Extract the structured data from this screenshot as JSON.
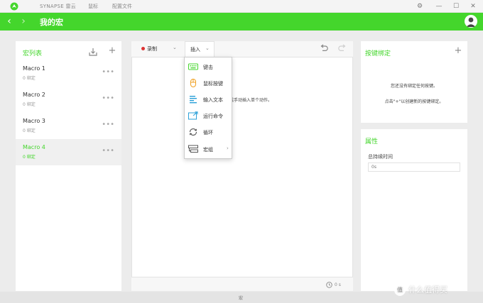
{
  "titlebar": {
    "app_name": "SYNAPSE 雷云",
    "menu_mouse": "鼠标",
    "menu_profile": "配置文件",
    "gear_glyph": "⚙",
    "minimize_glyph": "—",
    "maximize_glyph": "☐",
    "close_glyph": "✕"
  },
  "header": {
    "title": "我的宏",
    "back_glyph": "‹",
    "forward_glyph": "›",
    "accent_color": "#44d62c"
  },
  "macro_list": {
    "title": "宏列表",
    "items": [
      {
        "name": "Macro 1",
        "sub": "0 绑定",
        "active": false
      },
      {
        "name": "Macro 2",
        "sub": "0 绑定",
        "active": false
      },
      {
        "name": "Macro 3",
        "sub": "0 绑定",
        "active": false
      },
      {
        "name": "Macro 4",
        "sub": "0 绑定",
        "active": true
      }
    ],
    "more_glyph": "•••",
    "add_glyph": "+"
  },
  "editor": {
    "record_label": "录制",
    "insert_label": "插入",
    "caret_glyph": "⌄",
    "hint_text": "作或手动插入单个动作。",
    "timer_value": "0 s"
  },
  "insert_menu": {
    "items": [
      {
        "label": "键击",
        "icon": "keyboard-icon"
      },
      {
        "label": "鼠标按键",
        "icon": "mouse-icon"
      },
      {
        "label": "输入文本",
        "icon": "text-icon"
      },
      {
        "label": "运行命令",
        "icon": "run-command-icon"
      },
      {
        "label": "循环",
        "icon": "loop-icon"
      },
      {
        "label": "宏组",
        "icon": "macro-group-icon"
      }
    ],
    "submenu_glyph": "›"
  },
  "bindings": {
    "title": "按键绑定",
    "empty_line1": "您还没有绑定任何按键。",
    "empty_line2": "点击\"+\"以创建新的按键绑定。",
    "add_glyph": "+"
  },
  "properties": {
    "title": "属性",
    "duration_label": "总持续时间",
    "duration_placeholder": "0s"
  },
  "footer": {
    "label": "宏"
  },
  "watermark": {
    "badge": "值",
    "text": "什么值得买"
  }
}
